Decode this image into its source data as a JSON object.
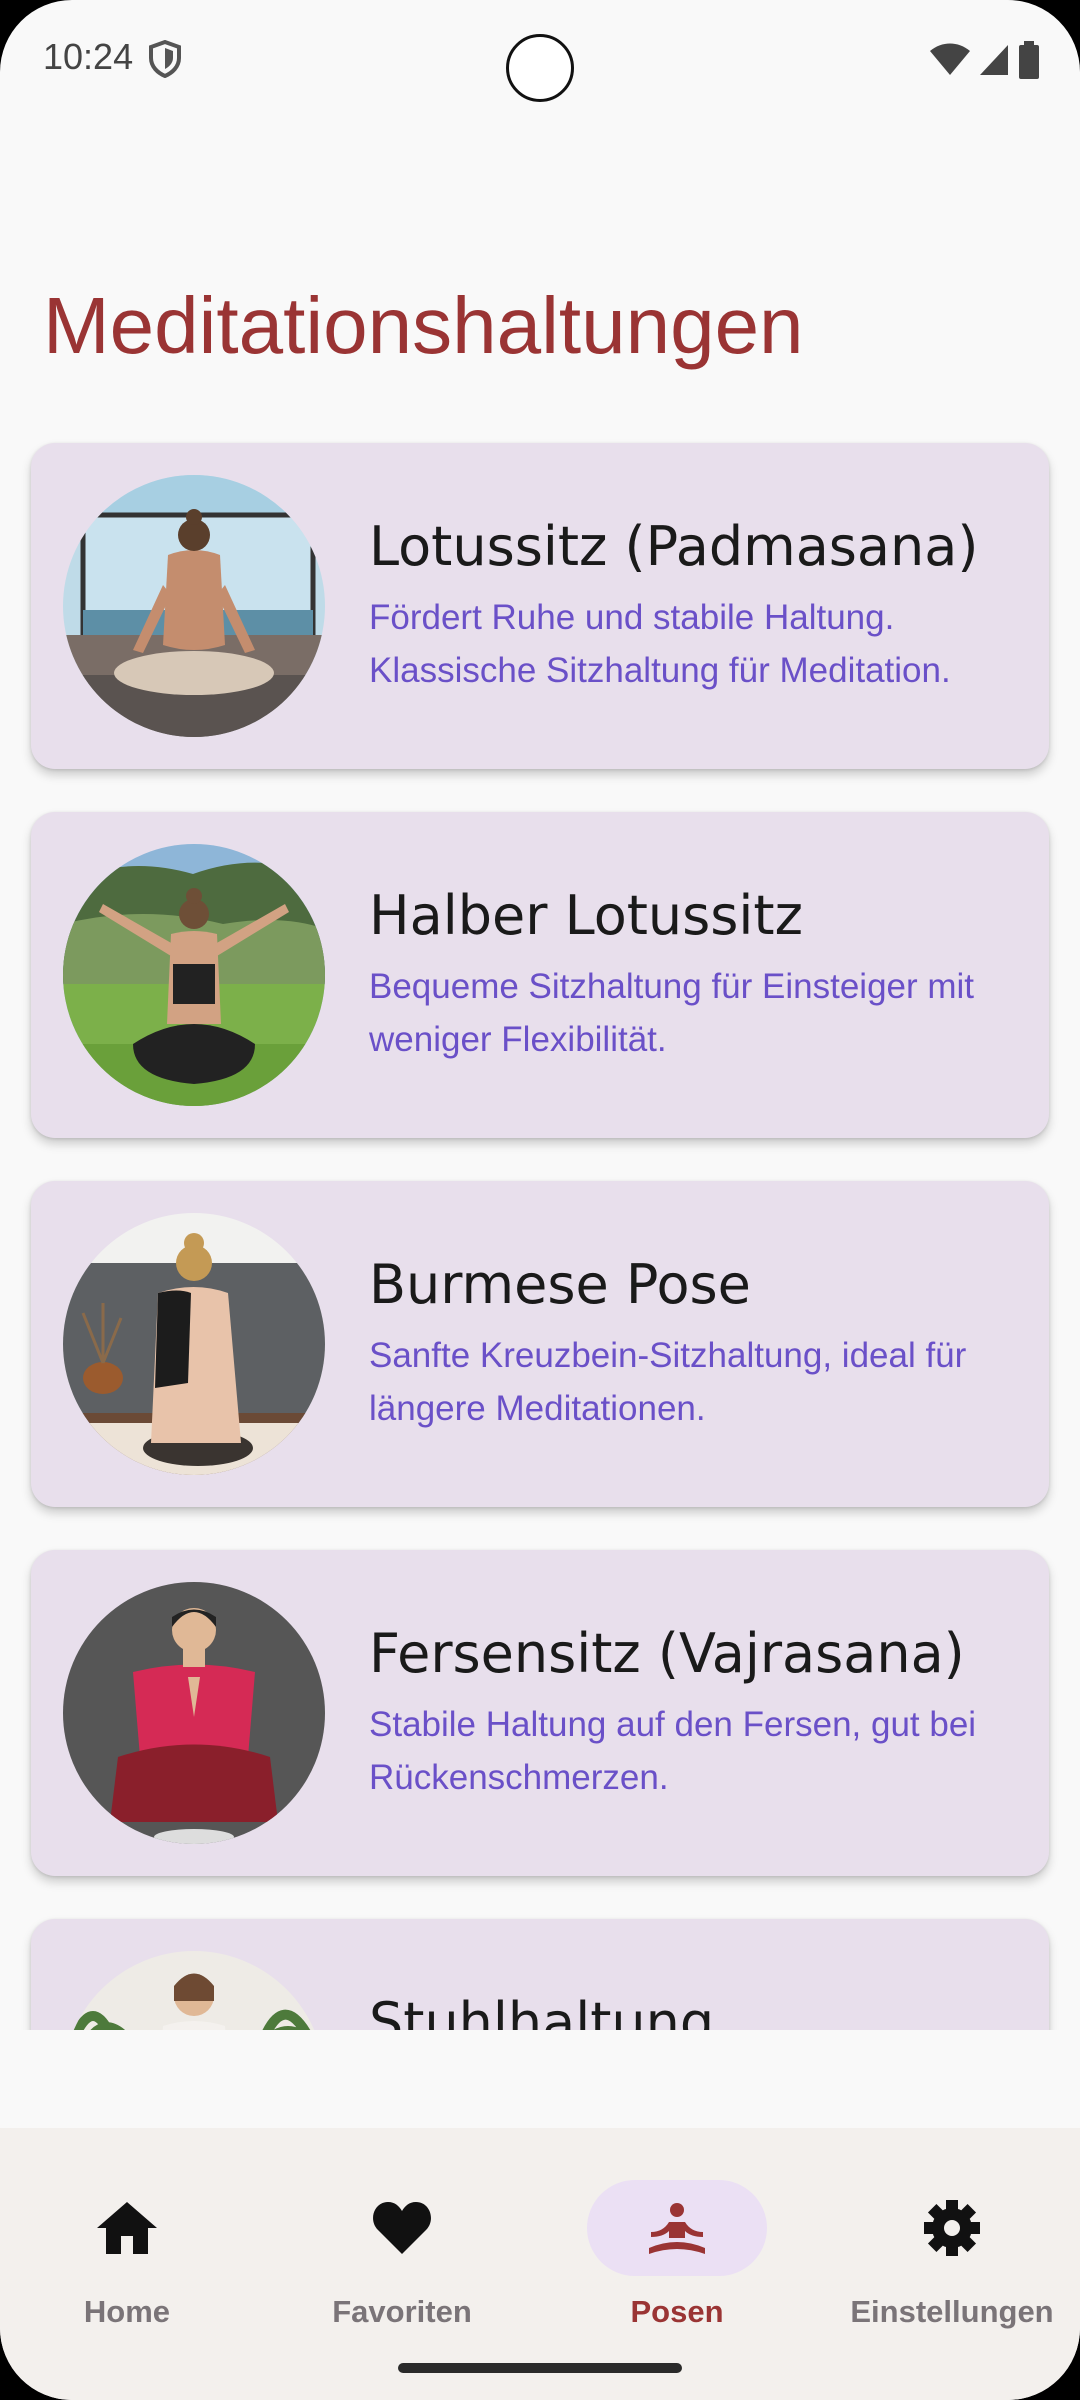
{
  "status_bar": {
    "time": "10:24"
  },
  "page": {
    "title": "Meditationshaltungen"
  },
  "poses": [
    {
      "title": "Lotussitz (Padmasana)",
      "description": "Fördert Ruhe und stabile Haltung. Klassische Sitzhaltung für Meditation."
    },
    {
      "title": "Halber Lotussitz",
      "description": "Bequeme Sitzhaltung für Einsteiger mit weniger Flexibilität."
    },
    {
      "title": "Burmese Pose",
      "description": "Sanfte Kreuzbein-Sitzhaltung, ideal für längere Meditationen."
    },
    {
      "title": "Fersensitz (Vajrasana)",
      "description": "Stabile Haltung auf den Fersen, gut bei Rückenschmerzen."
    },
    {
      "title": "Stuhlhaltung",
      "description": ""
    }
  ],
  "bottom_nav": {
    "items": [
      {
        "label": "Home",
        "icon": "home-icon",
        "active": false
      },
      {
        "label": "Favoriten",
        "icon": "heart-icon",
        "active": false
      },
      {
        "label": "Posen",
        "icon": "meditation-icon",
        "active": true
      },
      {
        "label": "Einstellungen",
        "icon": "gear-icon",
        "active": false
      }
    ]
  },
  "colors": {
    "title": "#9a3434",
    "card_background": "#e8dfec",
    "description_text": "#6a50c8",
    "active_nav": "#9a3434",
    "active_nav_pill": "#ebe0f4"
  }
}
